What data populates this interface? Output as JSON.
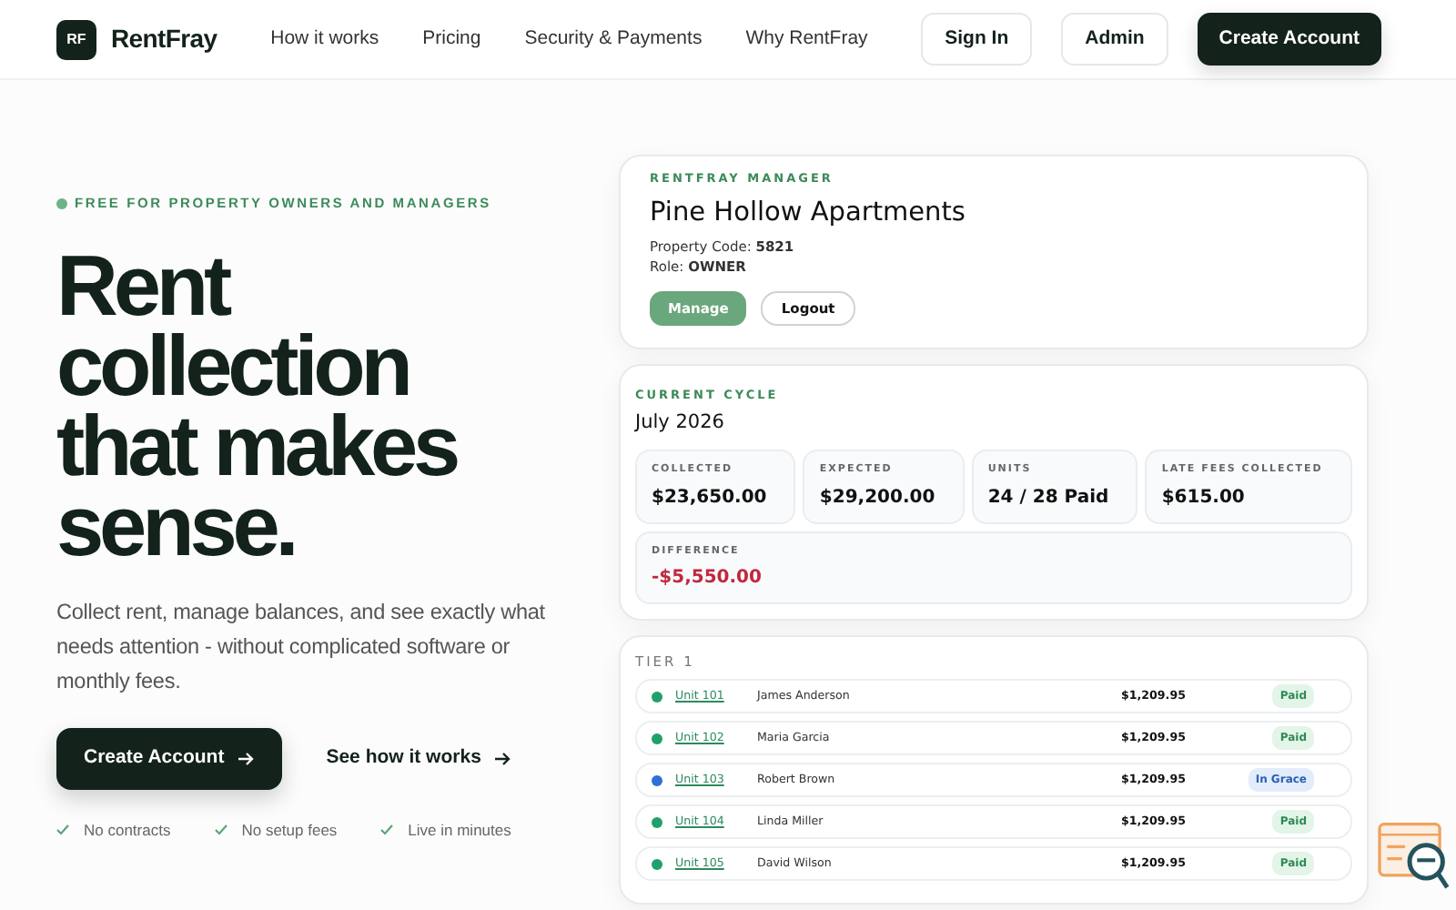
{
  "nav": {
    "logo_mark": "RF",
    "brand": "RentFray",
    "links": [
      "How it works",
      "Pricing",
      "Security & Payments",
      "Why RentFray"
    ],
    "actions": [
      {
        "label": "Sign In",
        "kind": "outline"
      },
      {
        "label": "Admin",
        "kind": "outline"
      },
      {
        "label": "Create Account",
        "kind": "dark"
      }
    ]
  },
  "hero": {
    "eyebrow": "FREE FOR PROPERTY OWNERS AND MANAGERS",
    "headline": [
      "Rent",
      "collection",
      "that makes",
      "sense."
    ],
    "lead": "Collect rent, manage balances, and see exactly what needs attention - without complicated software or monthly fees.",
    "primary_button": "Create Account",
    "secondary_link": "See how it works",
    "perks": [
      "No contracts",
      "No setup fees",
      "Live in minutes"
    ]
  },
  "manager_card": {
    "eyebrow": "RENTFRAY MANAGER",
    "property": "Pine Hollow Apartments",
    "property_code_label": "Property Code:",
    "property_code": "5821",
    "role_label": "Role:",
    "role": "OWNER",
    "buttons": [
      {
        "label": "Manage",
        "kind": "primary"
      },
      {
        "label": "Logout",
        "kind": "outline"
      }
    ]
  },
  "cycle_card": {
    "eyebrow": "CURRENT CYCLE",
    "period": "July 2026",
    "stats": [
      {
        "label": "COLLECTED",
        "value": "$23,650.00",
        "negative": false
      },
      {
        "label": "EXPECTED",
        "value": "$29,200.00",
        "negative": false
      },
      {
        "label": "UNITS",
        "value": "24 / 28 Paid",
        "negative": false
      },
      {
        "label": "LATE FEES COLLECTED",
        "value": "$615.00",
        "negative": false
      }
    ],
    "difference": {
      "label": "DIFFERENCE",
      "value": "-$5,550.00",
      "negative": true
    }
  },
  "tier_card": {
    "title": "TIER 1",
    "units": [
      {
        "unit": "Unit 101",
        "tenant": "James Anderson",
        "amount": "$1,209.95",
        "status": "Paid",
        "kind": "paid",
        "color": "#22a06b"
      },
      {
        "unit": "Unit 102",
        "tenant": "Maria Garcia",
        "amount": "$1,209.95",
        "status": "Paid",
        "kind": "paid",
        "color": "#22a06b"
      },
      {
        "unit": "Unit 103",
        "tenant": "Robert Brown",
        "amount": "$1,209.95",
        "status": "In Grace",
        "kind": "grace",
        "color": "#2f6fd6"
      },
      {
        "unit": "Unit 104",
        "tenant": "Linda Miller",
        "amount": "$1,209.95",
        "status": "Paid",
        "kind": "paid",
        "color": "#22a06b"
      },
      {
        "unit": "Unit 105",
        "tenant": "David Wilson",
        "amount": "$1,209.95",
        "status": "Paid",
        "kind": "paid",
        "color": "#22a06b"
      }
    ]
  }
}
